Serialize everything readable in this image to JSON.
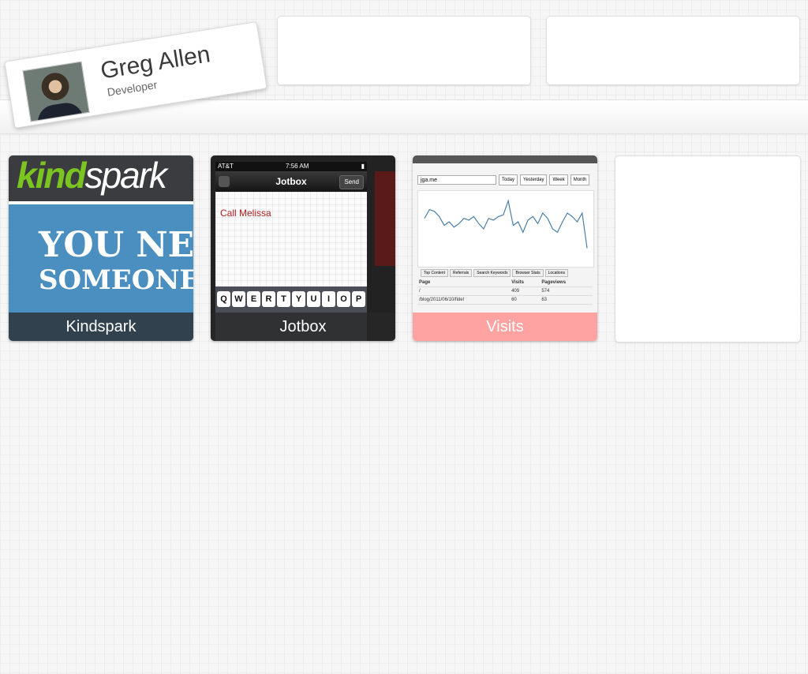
{
  "profile": {
    "name": "Greg Allen",
    "role": "Developer"
  },
  "apps": [
    {
      "label": "Kindspark",
      "logo_kind": "kind",
      "logo_spark": "spark",
      "hero_line1": "YOU NE",
      "hero_line2": "SOMEONE"
    },
    {
      "label": "Jotbox",
      "carrier": "AT&T",
      "time": "7:56 AM",
      "nav_title": "Jotbox",
      "send": "Send",
      "note": "Call Melissa",
      "keys": [
        "Q",
        "W",
        "E",
        "R",
        "T",
        "Y",
        "U",
        "I",
        "O",
        "P"
      ]
    },
    {
      "label": "Visits",
      "site": "jga.me",
      "ranges": [
        "Today",
        "Yesterday",
        "Week",
        "Month"
      ],
      "tabs": [
        "Top Content",
        "Referrals",
        "Search Keywords",
        "Browser Stats",
        "Locations"
      ],
      "table_header": [
        "Page",
        "Visits",
        "Pageviews"
      ],
      "rows": [
        [
          "/",
          "409",
          "574"
        ],
        [
          "/blog/2011/06/10/fidel",
          "60",
          "63"
        ]
      ],
      "chart_values": [
        24,
        29,
        28,
        25,
        20,
        22,
        19,
        21,
        24,
        23,
        25,
        21,
        18,
        24,
        23,
        25,
        26,
        34,
        20,
        22,
        16,
        23,
        25,
        21,
        27,
        24,
        18,
        16,
        22,
        27,
        25,
        22,
        27,
        7
      ]
    }
  ],
  "colors": {
    "kindspark_green": "#7cc520",
    "kindspark_blue": "#4b8fc0",
    "visits_label": "#ff9696"
  }
}
